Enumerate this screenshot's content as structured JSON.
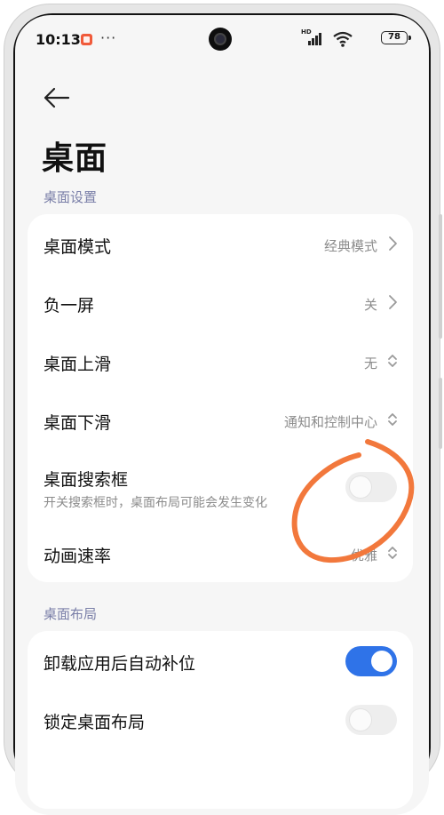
{
  "status_bar": {
    "time": "10:13",
    "more": "···",
    "signal_label": "HD",
    "battery": "78"
  },
  "header": {
    "title": "桌面"
  },
  "section_desktop_settings": {
    "label": "桌面设置",
    "rows": [
      {
        "label": "桌面模式",
        "value": "经典模式",
        "control": "chevron-right"
      },
      {
        "label": "负一屏",
        "value": "关",
        "control": "chevron-right"
      },
      {
        "label": "桌面上滑",
        "value": "无",
        "control": "chevron-updown"
      },
      {
        "label": "桌面下滑",
        "value": "通知和控制中心",
        "control": "chevron-updown"
      },
      {
        "label": "桌面搜索框",
        "subtitle": "开关搜索框时，桌面布局可能会发生变化",
        "control": "toggle",
        "toggle_on": false
      },
      {
        "label": "动画速率",
        "value": "优雅",
        "control": "chevron-updown"
      }
    ]
  },
  "section_desktop_layout": {
    "label": "桌面布局",
    "rows": [
      {
        "label": "卸载应用后自动补位",
        "control": "toggle",
        "toggle_on": true
      },
      {
        "label": "锁定桌面布局",
        "control": "toggle",
        "toggle_on": false
      }
    ]
  },
  "colors": {
    "accent": "#2f73e8",
    "section_label": "#7a7fa8",
    "annotation": "#f2783c",
    "screen_bg": "#f6f6f6"
  }
}
